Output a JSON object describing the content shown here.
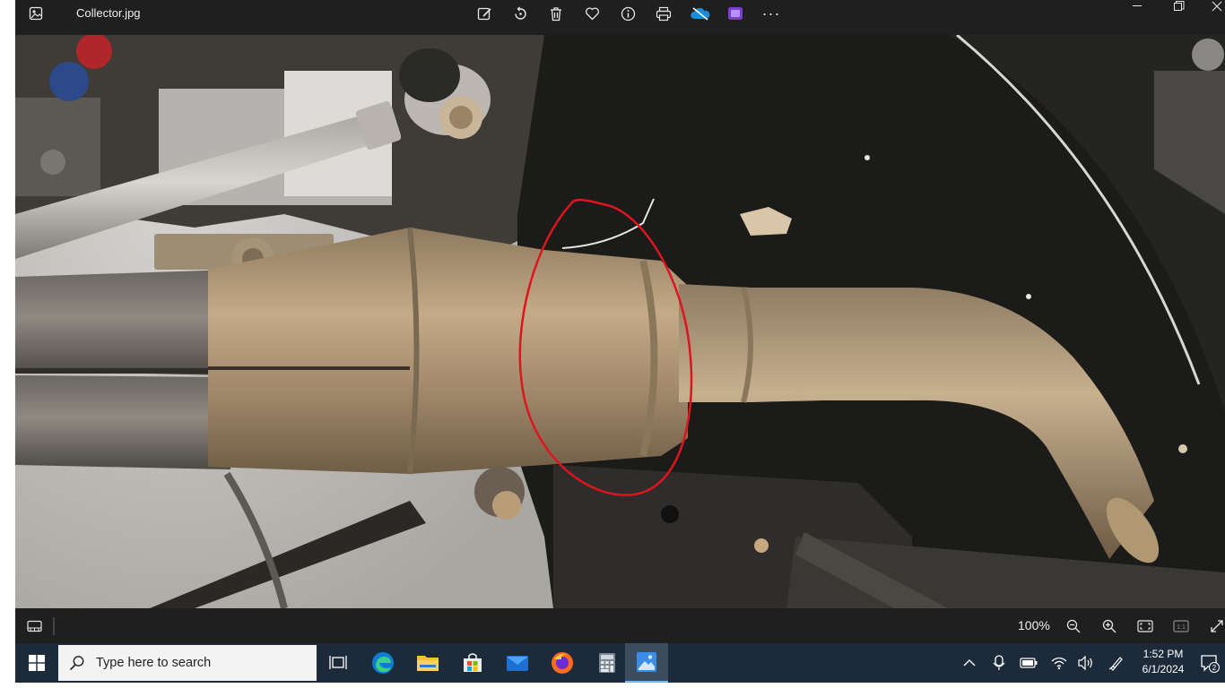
{
  "titlebar": {
    "file_name": "Collector.jpg",
    "icons": [
      "photos-app-icon",
      "edit-icon",
      "rotate-icon",
      "delete-icon",
      "favorite-icon",
      "info-icon",
      "print-icon",
      "onedrive-icon",
      "clipchamp-icon",
      "more-icon"
    ],
    "window_controls": [
      "minimize-icon",
      "restore-icon",
      "close-icon"
    ]
  },
  "viewer": {
    "image_subject": "exhaust-collector-photo"
  },
  "bottombar": {
    "zoom_level": "100%",
    "icons": [
      "filmstrip-icon",
      "zoom-out-icon",
      "zoom-in-icon",
      "fit-to-window-icon",
      "actual-size-icon",
      "fullscreen-icon"
    ]
  },
  "taskbar": {
    "search_placeholder": "Type here to search",
    "apps": [
      "task-view",
      "edge",
      "file-explorer",
      "microsoft-store",
      "mail",
      "firefox",
      "calculator",
      "photos"
    ],
    "clock_time": "1:52 PM",
    "clock_date": "6/1/2024",
    "notification_count": "2",
    "colors": {
      "taskbar": "#1c2a3a",
      "accent": "#76b9ed",
      "annotation": "#e0141e"
    }
  }
}
